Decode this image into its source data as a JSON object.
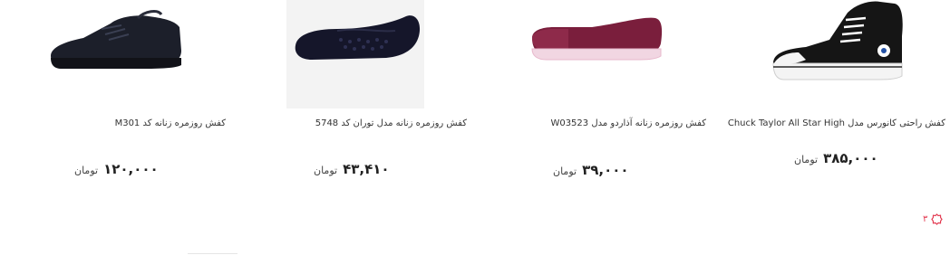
{
  "products": [
    {
      "title": "کفش روزمره زنانه کد M301",
      "price": "۱۲۰,۰۰۰",
      "currency": "تومان",
      "image": "black-mesh-lace-up-sneaker"
    },
    {
      "title": "کفش روزمره زنانه مدل توران کد 5748",
      "price": "۴۳,۴۱۰",
      "currency": "تومان",
      "image": "black-perforated-ballet-flat"
    },
    {
      "title": "کفش روزمره زنانه آذاردو مدل W03523",
      "price": "۳۹,۰۰۰",
      "currency": "تومان",
      "image": "burgundy-slip-on-sneaker"
    },
    {
      "title": "کفش راحتی کانورس مدل Chuck Taylor All Star High",
      "price": "۳۸۵,۰۰۰",
      "currency": "تومان",
      "image": "black-high-top-converse"
    }
  ],
  "pager": {
    "value": "۳",
    "icon": "red-badge-icon",
    "color": "#e33b52"
  }
}
